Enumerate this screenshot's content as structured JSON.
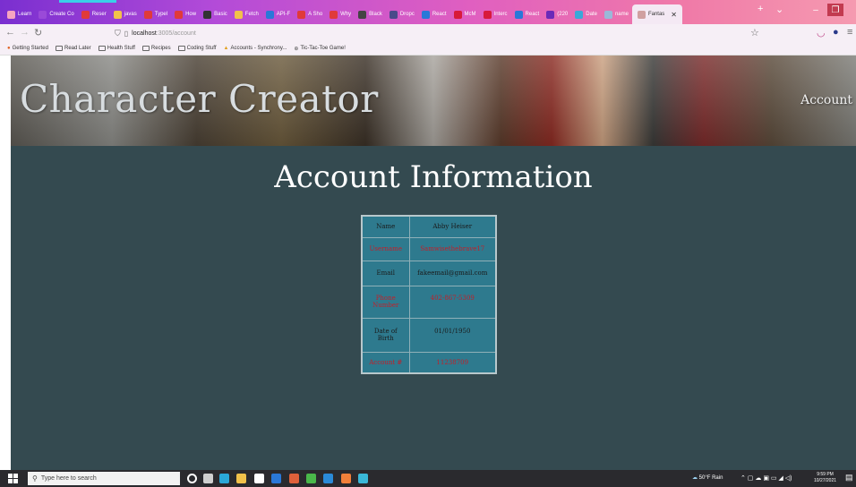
{
  "browser": {
    "tabs": [
      {
        "label": "Learn",
        "color": "#f6a4c0"
      },
      {
        "label": "Create Co",
        "color": "#9a4ad8"
      },
      {
        "label": "Reser",
        "color": "#e03a3a"
      },
      {
        "label": "javas",
        "color": "#f2c14a"
      },
      {
        "label": "Typel",
        "color": "#e03a3a"
      },
      {
        "label": "How",
        "color": "#e03a3a"
      },
      {
        "label": "Basic",
        "color": "#333333"
      },
      {
        "label": "Fetch",
        "color": "#f2c14a"
      },
      {
        "label": "API-F",
        "color": "#2a78d8"
      },
      {
        "label": "A Sho",
        "color": "#e03a3a"
      },
      {
        "label": "Why",
        "color": "#e03a3a"
      },
      {
        "label": "Black",
        "color": "#444444"
      },
      {
        "label": "Dropc",
        "color": "#4a4a8a"
      },
      {
        "label": "React",
        "color": "#2a78d8"
      },
      {
        "label": "McM",
        "color": "#d81a3a"
      },
      {
        "label": "Interc",
        "color": "#d81a3a"
      },
      {
        "label": "React",
        "color": "#2a78d8"
      },
      {
        "label": "(220",
        "color": "#6a2ab8"
      },
      {
        "label": "Date",
        "color": "#3aa8d8"
      },
      {
        "label": "name",
        "color": "#9ab8d8"
      }
    ],
    "active_tab": "Fantas",
    "url": "localhost",
    "url_path": ":3005/account",
    "bookmarks": [
      "Getting Started",
      "Read Later",
      "Health Stuff",
      "Recipes",
      "Coding Stuff",
      "Accounts - Synchrony...",
      "Tic-Tac-Toe Game!"
    ]
  },
  "site": {
    "title": "Character Creator",
    "nav_account": "Account",
    "heading": "Account Information"
  },
  "account": {
    "rows": [
      {
        "label": "Name",
        "value": "Abby Heiser"
      },
      {
        "label": "Username",
        "value": "Samwisethebrave17"
      },
      {
        "label": "Email",
        "value": "fakeemail@gmail.com"
      },
      {
        "label": "Phone Number",
        "value": "402-867-5309"
      },
      {
        "label": "Date of Birth",
        "value": "01/01/1950"
      },
      {
        "label": "Account #",
        "value": "11238709"
      }
    ]
  },
  "taskbar": {
    "search_placeholder": "Type here to search",
    "weather": "50°F Rain",
    "time": "9:59 PM",
    "date": "10/27/2021",
    "icons": [
      {
        "name": "task-view-icon",
        "color": "#ffffff"
      },
      {
        "name": "widgets-icon",
        "color": "#cfcfcf"
      },
      {
        "name": "edge-icon",
        "color": "#2aa8d8"
      },
      {
        "name": "file-explorer-icon",
        "color": "#f2c14a"
      },
      {
        "name": "store-icon",
        "color": "#ffffff"
      },
      {
        "name": "mail-icon",
        "color": "#2a78d8"
      },
      {
        "name": "office-icon",
        "color": "#e0603a"
      },
      {
        "name": "chrome-icon",
        "color": "#4ab84a"
      },
      {
        "name": "vscode-icon",
        "color": "#2a8ad8"
      },
      {
        "name": "firefox-icon",
        "color": "#f2803a"
      },
      {
        "name": "photos-icon",
        "color": "#3ab8d8"
      }
    ]
  }
}
